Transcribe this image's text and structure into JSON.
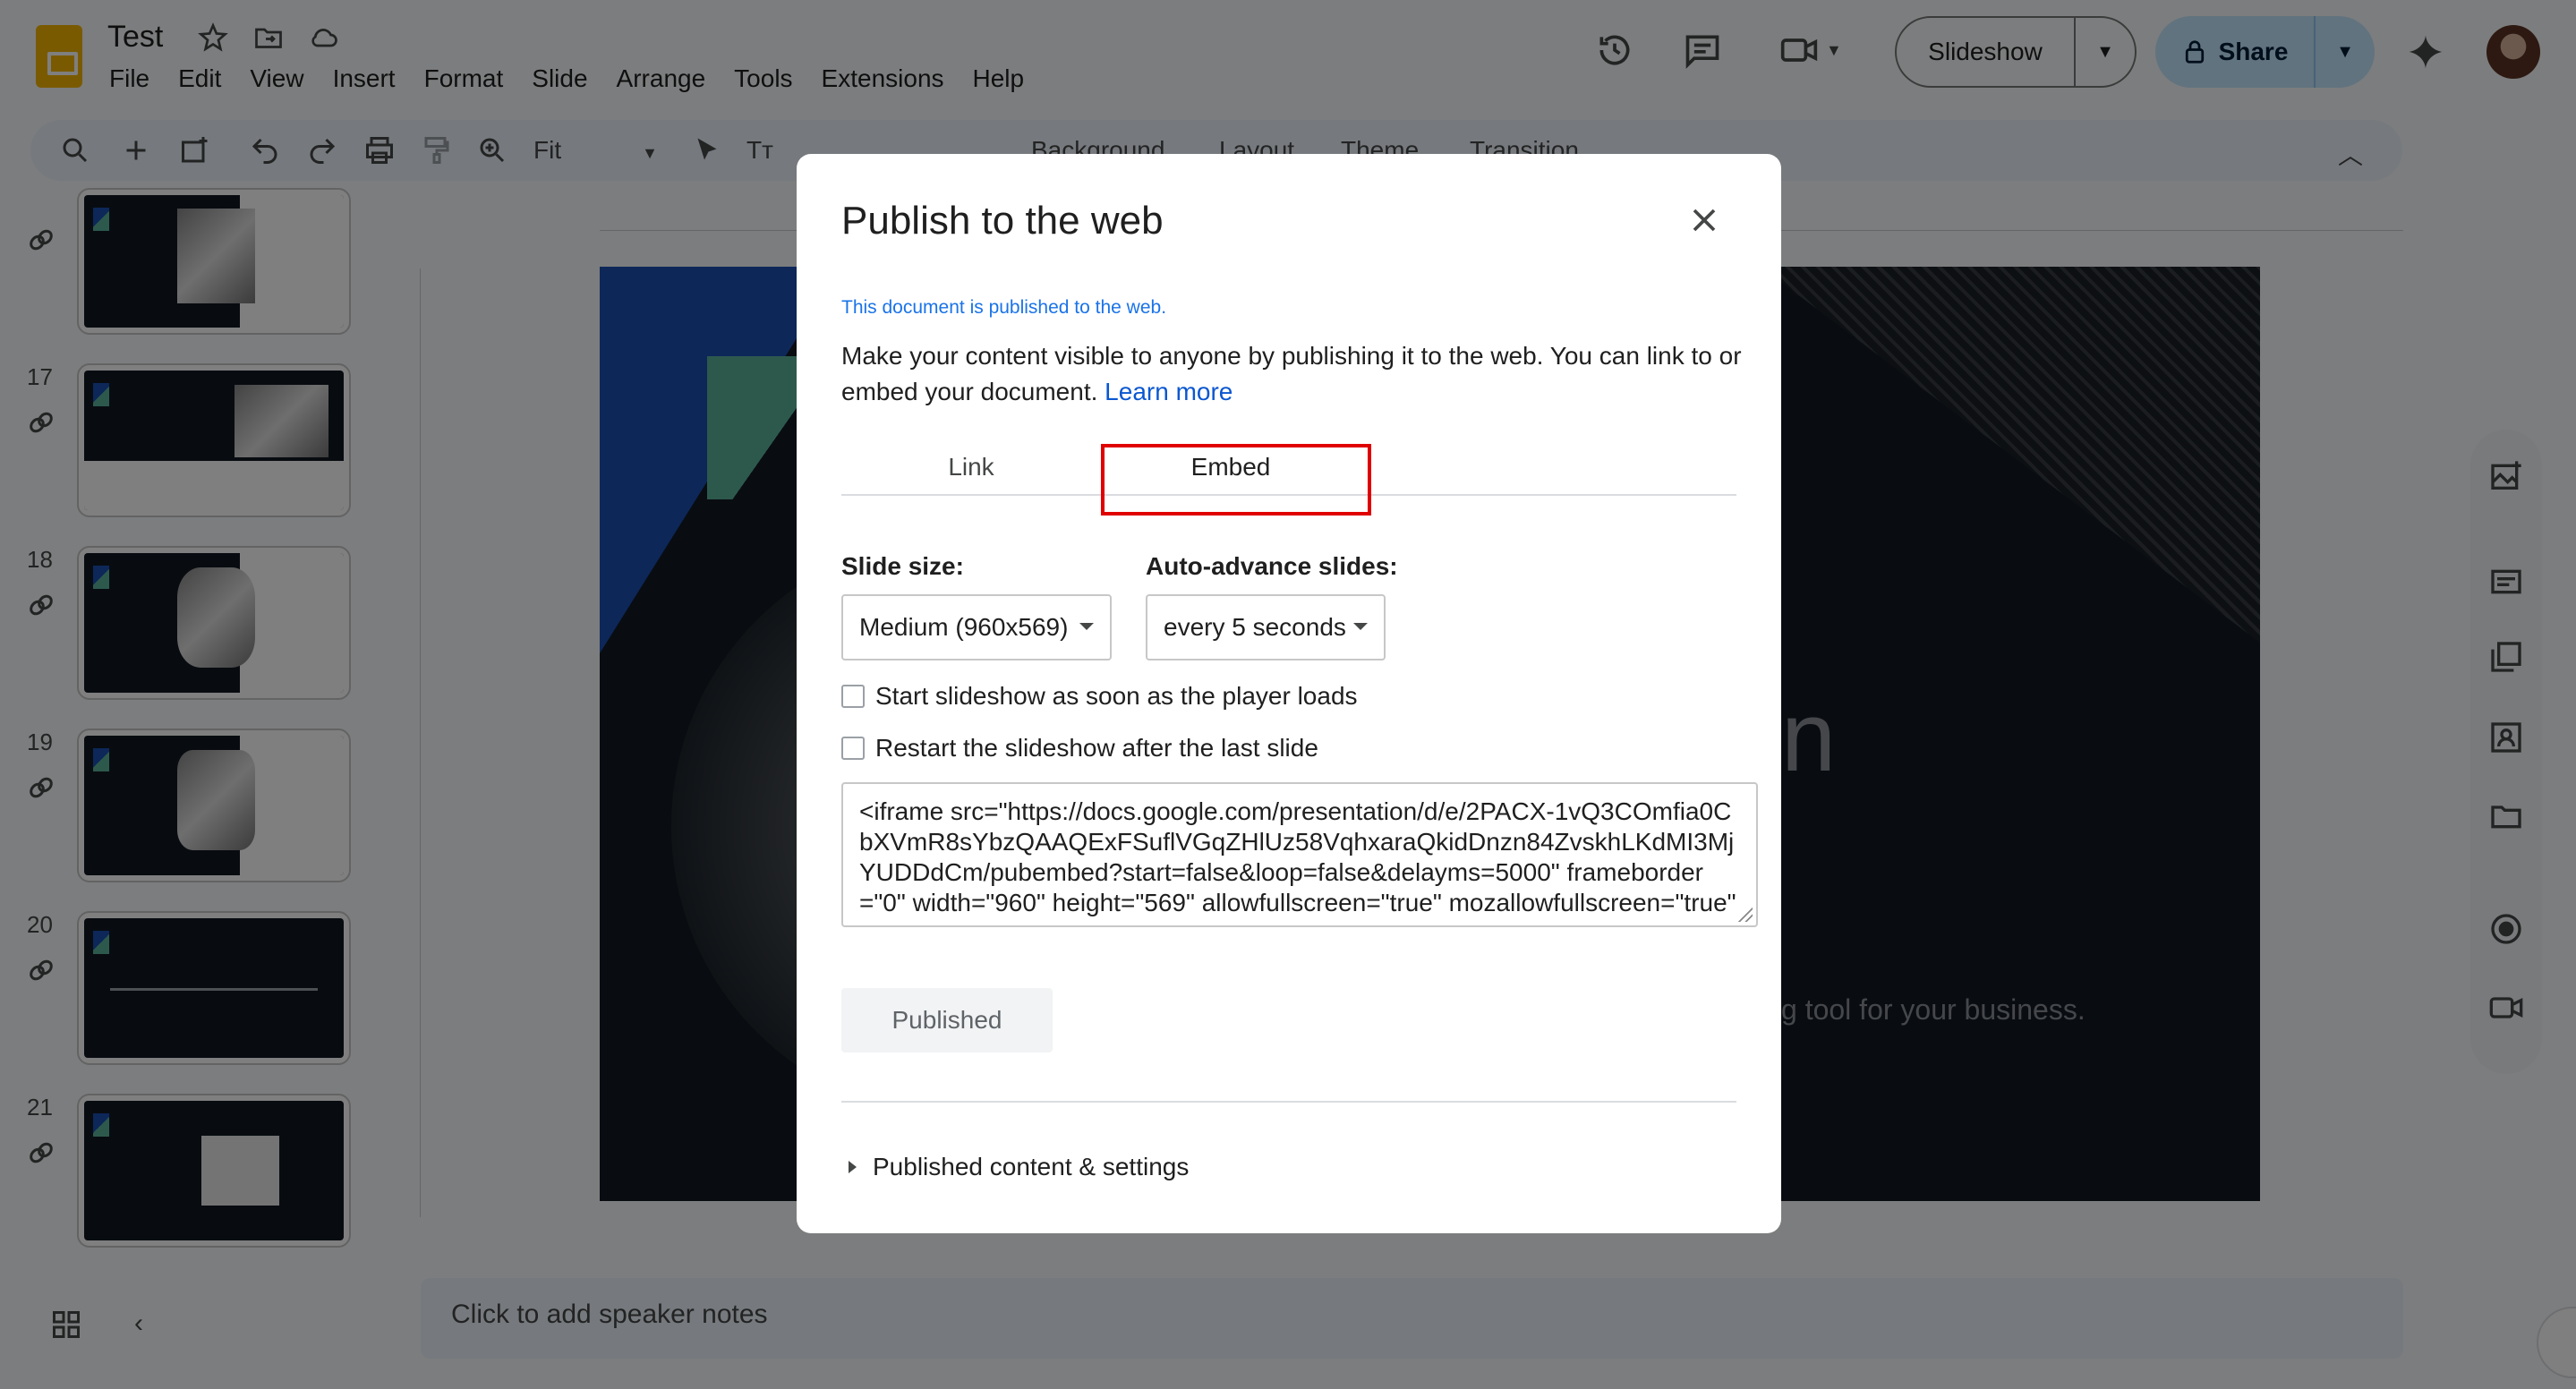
{
  "header": {
    "doc_title": "Test",
    "menu": [
      "File",
      "Edit",
      "View",
      "Insert",
      "Format",
      "Slide",
      "Arrange",
      "Tools",
      "Extensions",
      "Help"
    ],
    "slideshow_label": "Slideshow",
    "share_label": "Share"
  },
  "toolbar": {
    "zoom_value": "Fit",
    "background_label": "Background",
    "layout_label": "Layout",
    "theme_label": "Theme",
    "transition_label": "Transition"
  },
  "filmstrip": {
    "slides": [
      {
        "number": "17"
      },
      {
        "number": "18"
      },
      {
        "number": "19"
      },
      {
        "number": "20"
      },
      {
        "number": "21"
      }
    ]
  },
  "canvas": {
    "visible_text_fragment": "n",
    "tagline_fragment": "g tool for your business."
  },
  "speaker_notes": {
    "placeholder": "Click to add speaker notes"
  },
  "dialog": {
    "title": "Publish to the web",
    "status": "This document is published to the web.",
    "description": "Make your content visible to anyone by publishing it to the web. You can link to or embed your document.",
    "learn_more": "Learn more",
    "tabs": [
      "Link",
      "Embed"
    ],
    "active_tab": "Embed",
    "slide_size_label": "Slide size:",
    "slide_size_value": "Medium (960x569)",
    "auto_advance_label": "Auto-advance slides:",
    "auto_advance_value": "every 5 seconds",
    "checkbox_start": "Start slideshow as soon as the player loads",
    "checkbox_restart": "Restart the slideshow after the last slide",
    "embed_code": "<iframe src=\"https://docs.google.com/presentation/d/e/2PACX-1vQ3COmfia0CbXVmR8sYbzQAAQExFSuflVGqZHlUz58VqhxaraQkidDnzn84ZvskhLKdMI3MjYUDDdCm/pubembed?start=false&loop=false&delayms=5000\" frameborder=\"0\" width=\"960\" height=\"569\" allowfullscreen=\"true\" mozallowfullscreen=\"true\"",
    "published_label": "Published",
    "published_settings_label": "Published content & settings"
  },
  "colors": {
    "accent_blue": "#0b57d0",
    "share_bg": "#c2e7ff",
    "highlight_red": "#e00000"
  }
}
